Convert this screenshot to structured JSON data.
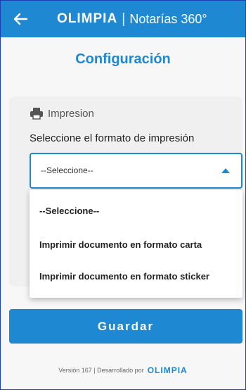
{
  "header": {
    "brand_logo": "olimpia",
    "separator": "|",
    "brand_sub": "Notarías 360°"
  },
  "page": {
    "title": "Configuración"
  },
  "section": {
    "icon": "printer-icon",
    "title": "Impresion",
    "label": "Seleccione el formato de impresión"
  },
  "select": {
    "value": "--Seleccione--",
    "options": [
      "--Seleccione--",
      "Imprimir documento en formato carta",
      "Imprimir documento en formato sticker"
    ]
  },
  "actions": {
    "save_label": "Guardar"
  },
  "footer": {
    "version_text": "Versión 167 | Desarrollado por",
    "logo": "olimpia"
  },
  "colors": {
    "accent": "#1f88d2",
    "border": "#1a3fb0"
  }
}
